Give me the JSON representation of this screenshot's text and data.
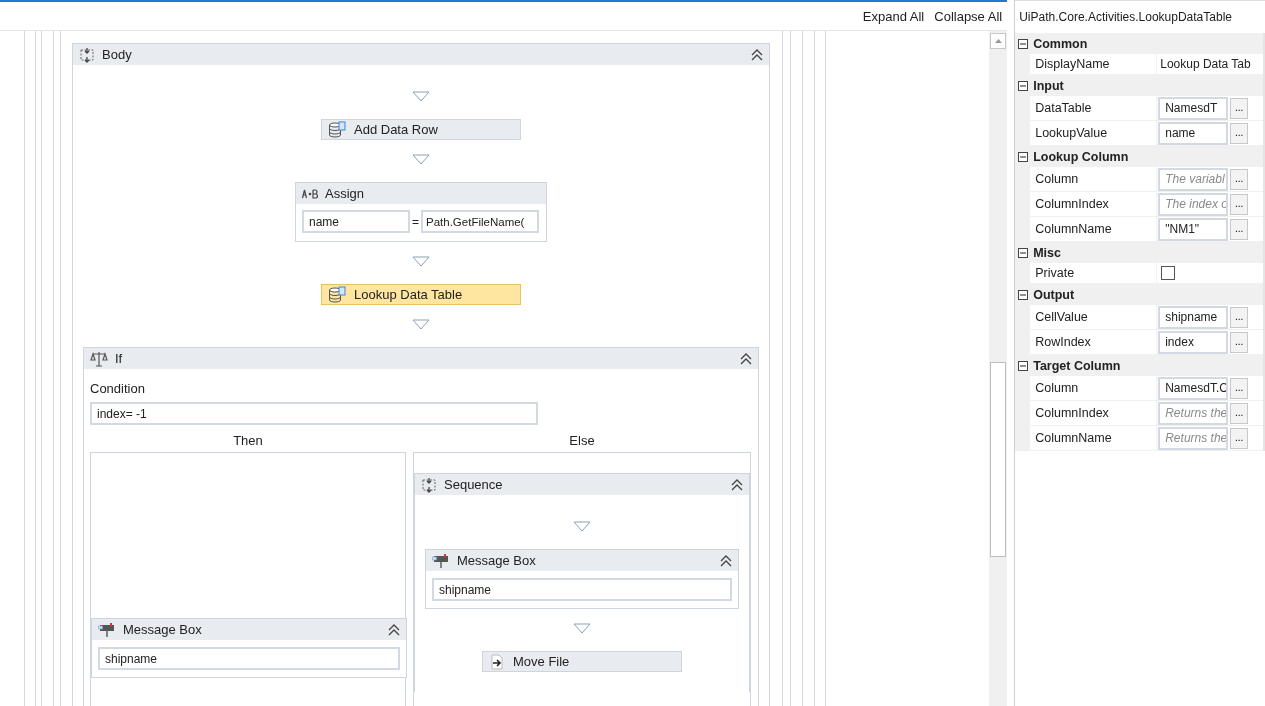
{
  "toolbar": {
    "buttons": [
      "Expand All",
      "Collapse All"
    ]
  },
  "body": {
    "title": "Body",
    "activities": [
      {
        "kind": "table",
        "title": "Add Data Row",
        "selected": false
      },
      {
        "kind": "assign",
        "title": "Assign",
        "to": "name",
        "operator": "=",
        "value": "Path.GetFileName(",
        "selected": false
      },
      {
        "kind": "table",
        "title": "Lookup Data Table",
        "selected": true
      },
      {
        "kind": "if",
        "title": "If",
        "selected": false,
        "condition_label": "Condition",
        "condition": "index= -1",
        "then_label": "Then",
        "else_label": "Else",
        "then": [
          {
            "kind": "message",
            "title": "Message Box",
            "text": "shipname",
            "selected": false
          }
        ],
        "else": [
          {
            "kind": "sequence",
            "title": "Sequence",
            "selected": false,
            "activities": [
              {
                "kind": "message",
                "title": "Message Box",
                "text": "shipname",
                "selected": false
              },
              {
                "kind": "file",
                "title": "Move File",
                "selected": false
              }
            ]
          }
        ]
      }
    ]
  },
  "properties": {
    "title": "UiPath.Core.Activities.LookupDataTable",
    "categories": [
      {
        "name": "Common",
        "expanded": true,
        "items": [
          {
            "kind": "plain",
            "name": "DisplayName",
            "value": "Lookup Data Tab"
          }
        ]
      },
      {
        "name": "Input",
        "expanded": true,
        "items": [
          {
            "kind": "text",
            "name": "DataTable",
            "value": "NamesdT",
            "button": "..."
          },
          {
            "kind": "text",
            "name": "LookupValue",
            "value": "name",
            "button": "..."
          }
        ]
      },
      {
        "name": "Lookup Column",
        "expanded": true,
        "items": [
          {
            "kind": "text",
            "name": "Column",
            "placeholder": "The variabl",
            "button": "..."
          },
          {
            "kind": "text",
            "name": "ColumnIndex",
            "placeholder": "The index o",
            "button": "..."
          },
          {
            "kind": "text",
            "name": "ColumnName",
            "value": "\"NM1\"",
            "button": "..."
          }
        ]
      },
      {
        "name": "Misc",
        "expanded": true,
        "items": [
          {
            "kind": "checkbox",
            "name": "Private",
            "checked": false
          }
        ]
      },
      {
        "name": "Output",
        "expanded": true,
        "items": [
          {
            "kind": "text",
            "name": "CellValue",
            "value": "shipname",
            "button": "..."
          },
          {
            "kind": "text",
            "name": "RowIndex",
            "value": "index",
            "button": "..."
          }
        ]
      },
      {
        "name": "Target Column",
        "expanded": true,
        "items": [
          {
            "kind": "text",
            "name": "Column",
            "value": "NamesdT.C",
            "button": "..."
          },
          {
            "kind": "text",
            "name": "ColumnIndex",
            "placeholder": "Returns the",
            "button": "..."
          },
          {
            "kind": "text",
            "name": "ColumnName",
            "placeholder": "Returns the",
            "button": "..."
          }
        ]
      }
    ]
  }
}
